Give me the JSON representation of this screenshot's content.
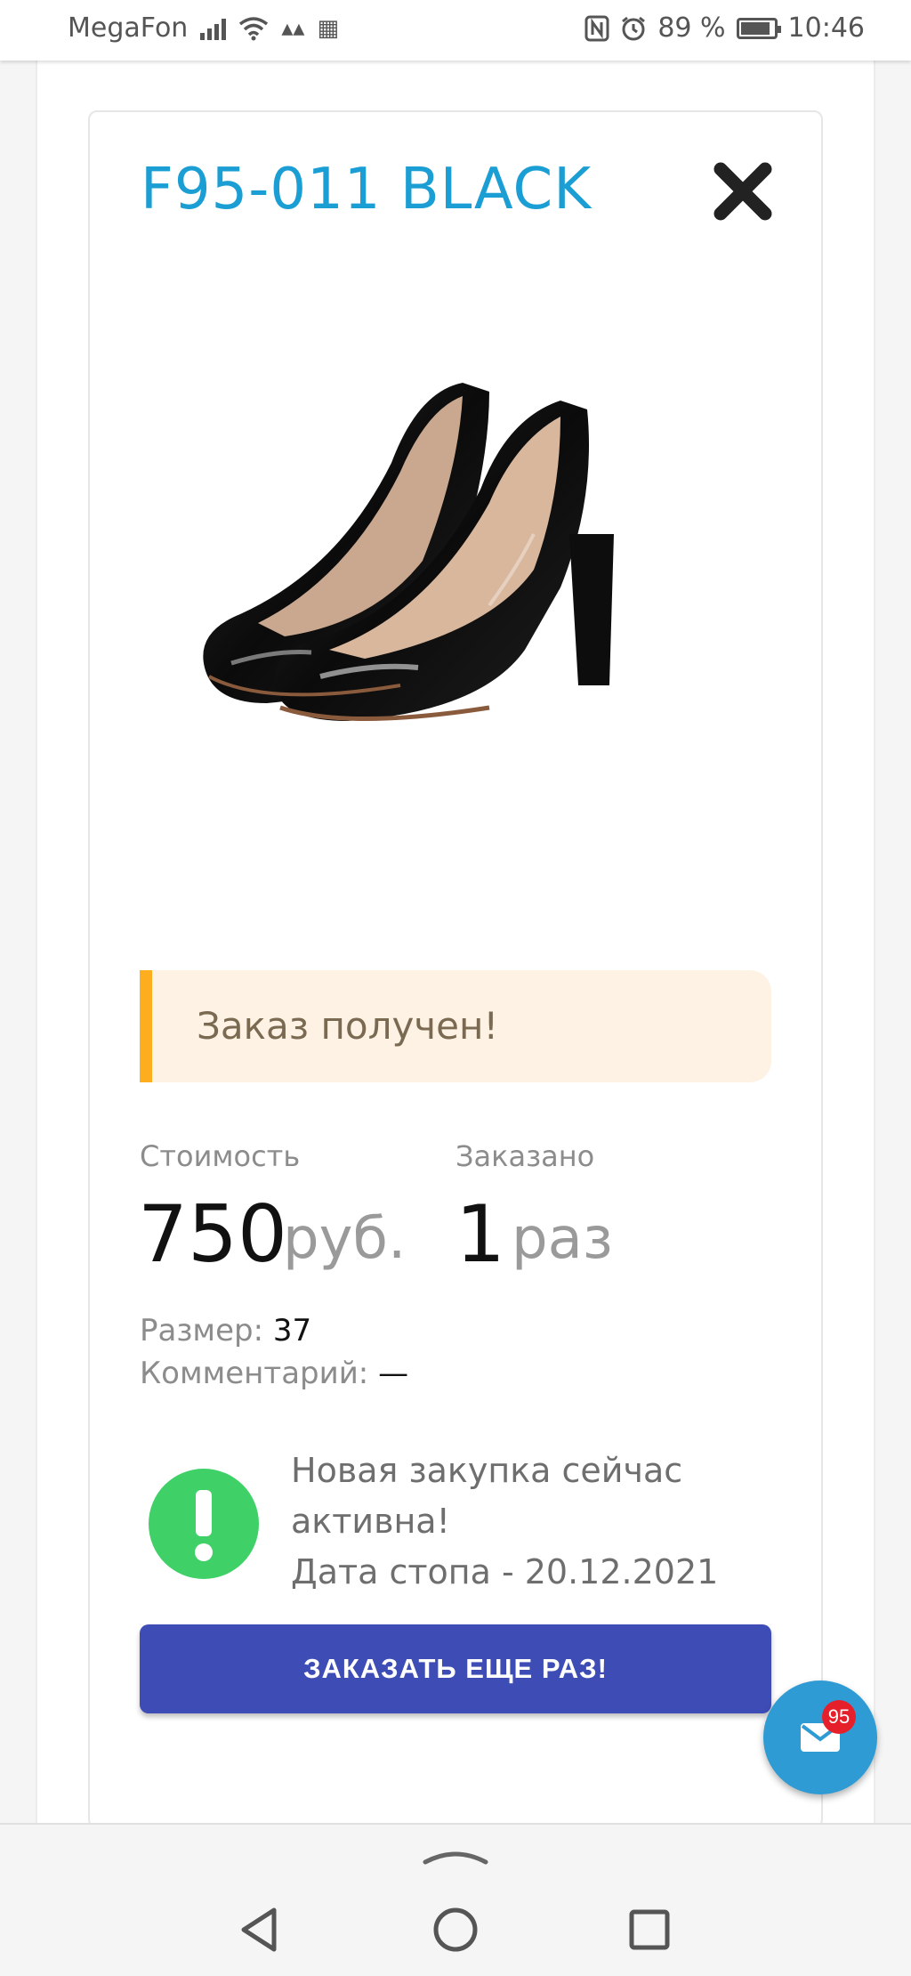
{
  "status_bar": {
    "carrier": "MegaFon",
    "battery_percent": "89 %",
    "battery_level": 0.89,
    "time": "10:46"
  },
  "product": {
    "title": "F95-011 BLACK",
    "image": "black-patent-pumps"
  },
  "alert": {
    "text": "Заказ получен!"
  },
  "stats": {
    "cost_label": "Стоимость",
    "cost_value": "750",
    "cost_unit": "руб.",
    "ordered_label": "Заказано",
    "ordered_value": "1",
    "ordered_unit": "раз"
  },
  "details": {
    "size_label": "Размер:",
    "size_value": "37",
    "comment_label": "Комментарий:",
    "comment_value": "—"
  },
  "purchase_status": {
    "line1": "Новая закупка сейчас",
    "line2": "активна!",
    "line3": "Дата стопа - 20.12.2021"
  },
  "order_again_button": "ЗАКАЗАТЬ ЕЩЕ РАЗ!",
  "messages_fab": {
    "badge_count": "95"
  },
  "colors": {
    "title": "#1a9ed4",
    "alert_accent": "#fcae1e",
    "alert_bg": "#fdf2e3",
    "button": "#3e4db5",
    "success": "#3fd167",
    "fab": "#2f9bd4",
    "badge": "#e5202a"
  }
}
